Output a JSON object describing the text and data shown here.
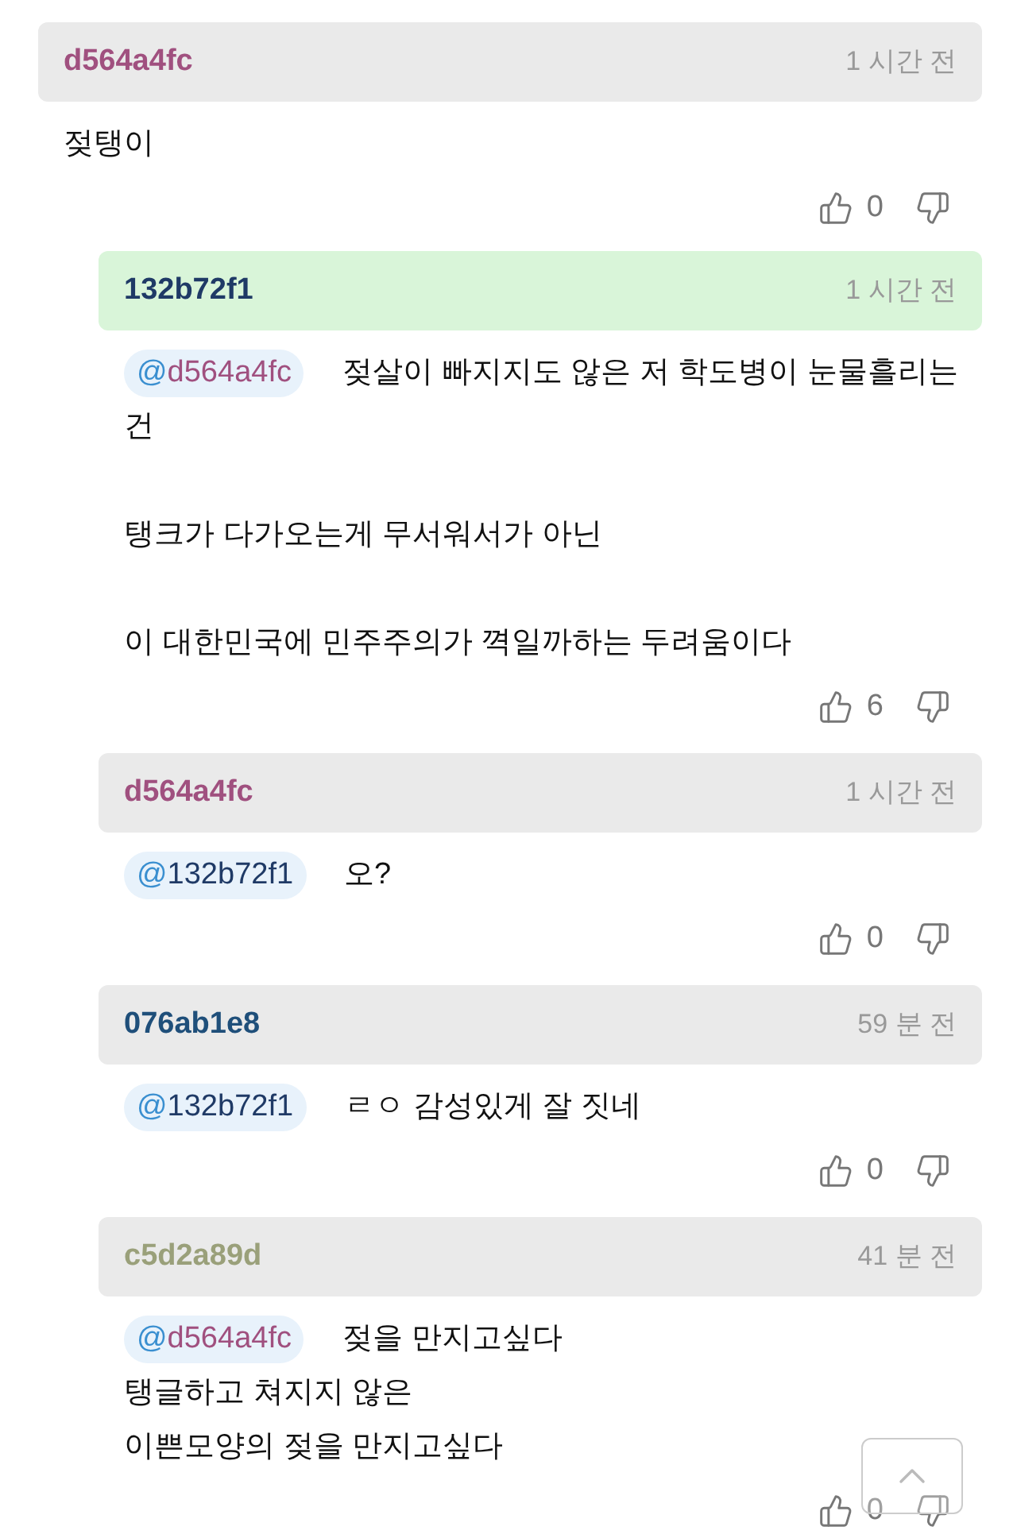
{
  "comments": [
    {
      "author": "d564a4fc",
      "color": "#a0507f",
      "time": "1 시간 전",
      "highlighted": false,
      "paragraphs": [
        [
          "젖탱이"
        ]
      ],
      "likes": "0",
      "children": [
        {
          "author": "132b72f1",
          "color": "#1f3a66",
          "time": "1 시간 전",
          "highlighted": true,
          "mention": {
            "at": "@",
            "name": "d564a4fc",
            "color": "#a0507f"
          },
          "paragraphs": [
            [
              "젖살이 빠지지도 않은 저 학도병이 눈물흘리는",
              "건"
            ],
            [
              "탱크가 다가오는게 무서워서가 아닌"
            ],
            [
              "이 대한민국에 민주주의가 껵일까하는 두려움이다"
            ]
          ],
          "likes": "6"
        },
        {
          "author": "d564a4fc",
          "color": "#a0507f",
          "time": "1 시간 전",
          "highlighted": false,
          "mention": {
            "at": "@",
            "name": "132b72f1",
            "color": "#1f3a66"
          },
          "paragraphs": [
            [
              "오?"
            ]
          ],
          "likes": "0"
        },
        {
          "author": "076ab1e8",
          "color": "#1f4f7a",
          "time": "59 분 전",
          "highlighted": false,
          "mention": {
            "at": "@",
            "name": "132b72f1",
            "color": "#1f3a66"
          },
          "paragraphs": [
            [
              "ㄹㅇ 감성있게 잘 짓네"
            ]
          ],
          "likes": "0"
        },
        {
          "author": "c5d2a89d",
          "color": "#9aa07a",
          "time": "41 분 전",
          "highlighted": false,
          "mention": {
            "at": "@",
            "name": "d564a4fc",
            "color": "#a0507f"
          },
          "paragraphs": [
            [
              "젖을 만지고싶다",
              "탱글하고 쳐지지 않은",
              "이쁜모양의 젖을 만지고싶다"
            ]
          ],
          "likes": "0"
        }
      ]
    }
  ]
}
